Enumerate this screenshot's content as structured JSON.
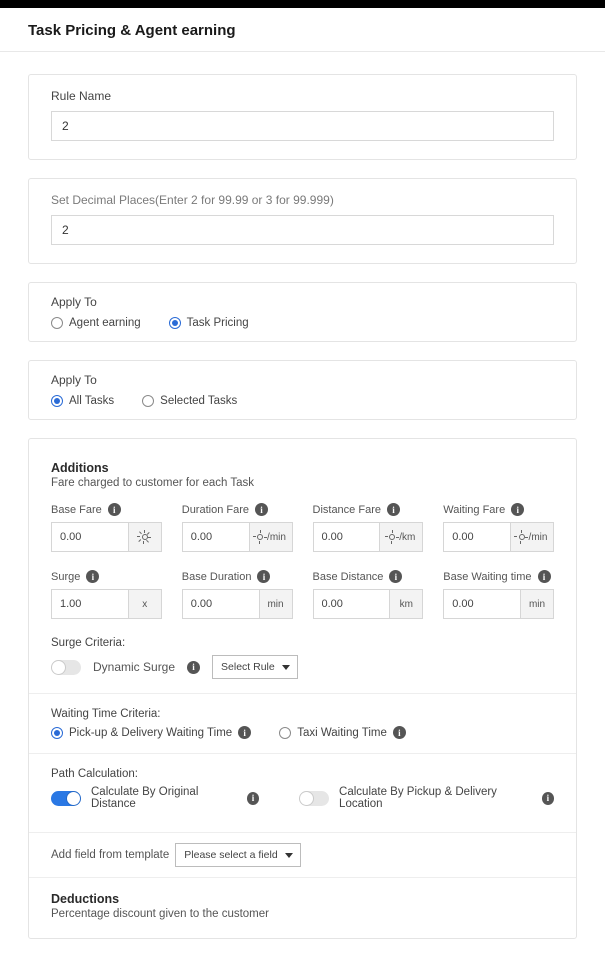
{
  "header": {
    "title": "Task Pricing & Agent earning"
  },
  "ruleName": {
    "label": "Rule Name",
    "value": "2"
  },
  "decimalPlaces": {
    "label": "Set Decimal Places(Enter 2 for 99.99 or 3 for 99.999)",
    "value": "2"
  },
  "applyTo1": {
    "label": "Apply To",
    "options": [
      {
        "label": "Agent earning",
        "selected": false
      },
      {
        "label": "Task Pricing",
        "selected": true
      }
    ]
  },
  "applyTo2": {
    "label": "Apply To",
    "options": [
      {
        "label": "All Tasks",
        "selected": true
      },
      {
        "label": "Selected Tasks",
        "selected": false
      }
    ]
  },
  "additions": {
    "title": "Additions",
    "subtitle": "Fare charged to customer for each Task",
    "row1": {
      "baseFare": {
        "label": "Base Fare",
        "value": "0.00",
        "unit": ""
      },
      "durationFare": {
        "label": "Duration Fare",
        "value": "0.00",
        "unit": "/min"
      },
      "distanceFare": {
        "label": "Distance Fare",
        "value": "0.00",
        "unit": "/km"
      },
      "waitingFare": {
        "label": "Waiting Fare",
        "value": "0.00",
        "unit": "/min"
      }
    },
    "row2": {
      "surge": {
        "label": "Surge",
        "value": "1.00",
        "unit": "x"
      },
      "baseDuration": {
        "label": "Base Duration",
        "value": "0.00",
        "unit": "min"
      },
      "baseDistance": {
        "label": "Base Distance",
        "value": "0.00",
        "unit": "km"
      },
      "baseWaiting": {
        "label": "Base Waiting time",
        "value": "0.00",
        "unit": "min"
      }
    },
    "surgeCriteria": {
      "label": "Surge Criteria:",
      "dynamicSurge": "Dynamic Surge",
      "selectRule": "Select Rule"
    },
    "waitingCriteria": {
      "label": "Waiting Time Criteria:",
      "options": [
        {
          "label": "Pick-up & Delivery Waiting Time",
          "selected": true
        },
        {
          "label": "Taxi Waiting Time",
          "selected": false
        }
      ]
    },
    "pathCalc": {
      "label": "Path Calculation:",
      "opt1": "Calculate By Original Distance",
      "opt2": "Calculate By Pickup & Delivery Location"
    },
    "addField": {
      "label": "Add field from template",
      "placeholder": "Please select a field"
    }
  },
  "deductions": {
    "title": "Deductions",
    "subtitle": "Percentage discount given to the customer"
  }
}
